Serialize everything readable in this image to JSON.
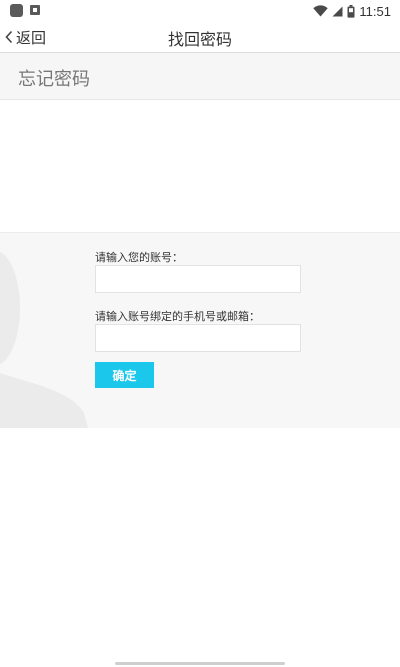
{
  "status_bar": {
    "time": "11:51",
    "icons": [
      "notification-icon",
      "accessibility-icon",
      "wifi-icon",
      "signal-icon",
      "battery-icon"
    ]
  },
  "nav": {
    "back_label": "返回",
    "title": "找回密码"
  },
  "header": {
    "title": "忘记密码"
  },
  "form": {
    "account_label": "请输入您的账号：",
    "account_value": "",
    "contact_label": "请输入账号绑定的手机号或邮箱：",
    "contact_value": "",
    "confirm_label": "确定"
  },
  "colors": {
    "accent": "#1cc7ec",
    "band": "#f7f7f7",
    "header_bg": "#f6f6f6"
  }
}
